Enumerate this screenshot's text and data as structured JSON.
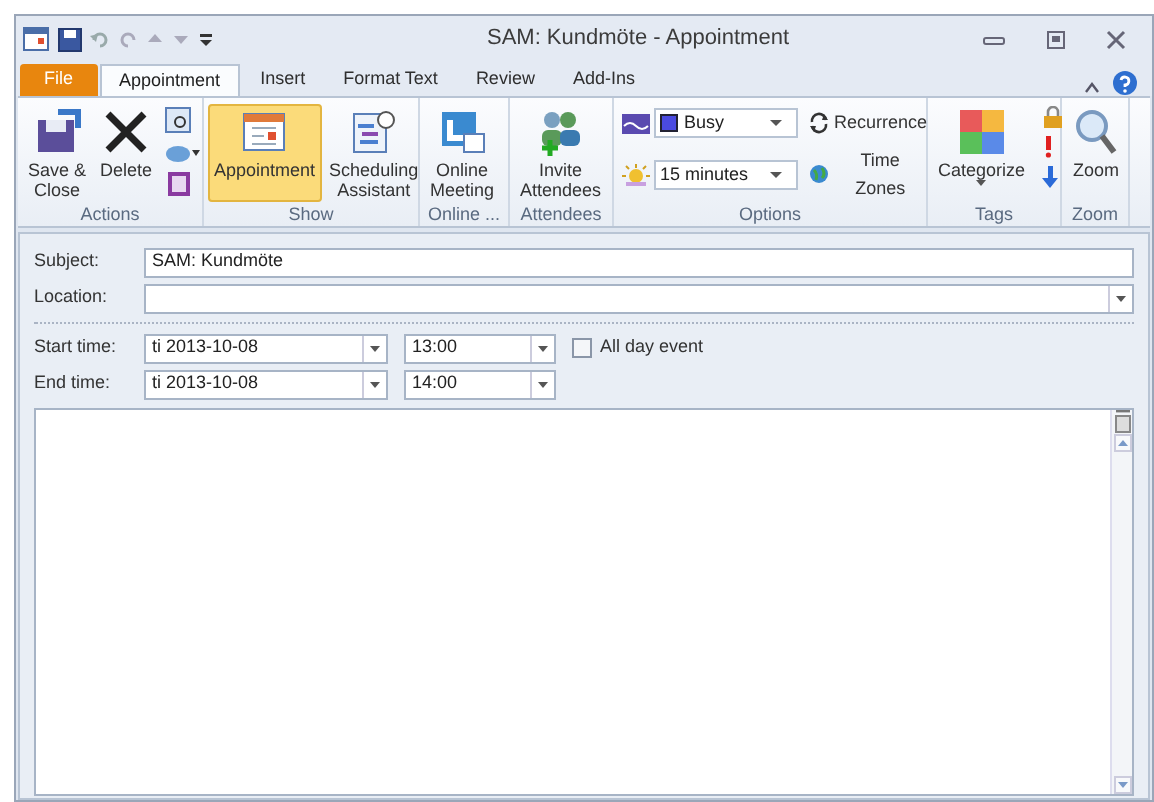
{
  "window": {
    "title": "SAM: Kundmöte - Appointment"
  },
  "tabs": [
    {
      "label": "File",
      "kind": "file",
      "selected": false
    },
    {
      "label": "Appointment",
      "kind": "tab",
      "selected": true
    },
    {
      "label": "Insert",
      "kind": "tab",
      "selected": false
    },
    {
      "label": "Format Text",
      "kind": "tab",
      "selected": false
    },
    {
      "label": "Review",
      "kind": "tab",
      "selected": false
    },
    {
      "label": "Add-Ins",
      "kind": "tab",
      "selected": false
    }
  ],
  "ribbon": {
    "actions": {
      "label": "Actions",
      "save": "Save &\nClose",
      "delete": "Delete"
    },
    "show": {
      "label": "Show",
      "buttons": [
        {
          "label": "Appointment",
          "selected": true
        },
        {
          "label": "Scheduling\nAssistant",
          "selected": false
        }
      ]
    },
    "online": {
      "label": "Online ...",
      "button": "Online\nMeeting"
    },
    "attendees": {
      "label": "Attendees",
      "button": "Invite\nAttendees"
    },
    "options": {
      "label": "Options",
      "show_as": "Busy",
      "reminder": "15 minutes",
      "recurrence": "Recurrence",
      "time_zones": "Time Zones"
    },
    "tags": {
      "label": "Tags",
      "button": "Categorize"
    },
    "zoom": {
      "label": "Zoom",
      "button": "Zoom"
    }
  },
  "form": {
    "subject": {
      "label": "Subject:",
      "value": "SAM: Kundmöte"
    },
    "location": {
      "label": "Location:"
    },
    "start": {
      "label": "Start time:",
      "date": "ti 2013-10-08",
      "time": "13:00"
    },
    "end": {
      "label": "End time:",
      "date": "ti 2013-10-08",
      "time": "14:00"
    },
    "all_day": {
      "label": "All day event",
      "checked": false
    }
  }
}
